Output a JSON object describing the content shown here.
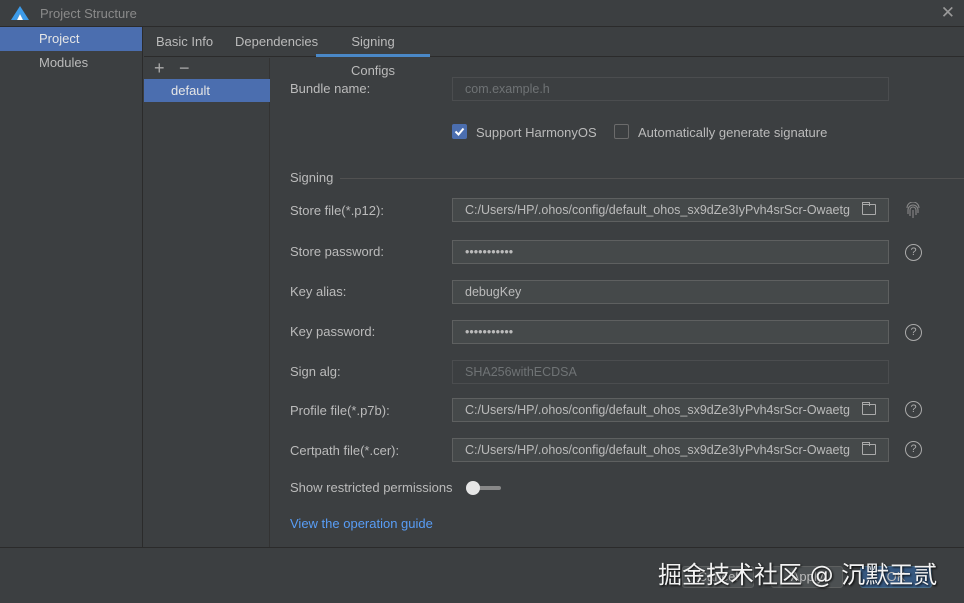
{
  "window": {
    "title": "Project Structure"
  },
  "nav": {
    "items": [
      {
        "label": "Project"
      },
      {
        "label": "Modules"
      }
    ]
  },
  "tabs": [
    {
      "label": "Basic Info"
    },
    {
      "label": "Dependencies"
    },
    {
      "label": "Signing Configs"
    }
  ],
  "configs": {
    "add": "+",
    "remove": "−",
    "items": [
      "default"
    ]
  },
  "form": {
    "bundle_name": {
      "label": "Bundle name:",
      "placeholder": "com.example.h"
    },
    "support_harmony": {
      "label": "Support HarmonyOS",
      "checked": true
    },
    "auto_sign": {
      "label": "Automatically generate signature",
      "checked": false
    },
    "section": "Signing",
    "store_file": {
      "label": "Store file(*.p12):",
      "value": "C:/Users/HP/.ohos/config/default_ohos_sx9dZe3IyPvh4srScr-Owaetg"
    },
    "store_password": {
      "label": "Store password:",
      "value": "•••••••••••"
    },
    "key_alias": {
      "label": "Key alias:",
      "value": "debugKey"
    },
    "key_password": {
      "label": "Key password:",
      "value": "•••••••••••"
    },
    "sign_alg": {
      "label": "Sign alg:",
      "value": "SHA256withECDSA"
    },
    "profile_file": {
      "label": "Profile file(*.p7b):",
      "value": "C:/Users/HP/.ohos/config/default_ohos_sx9dZe3IyPvh4srScr-Owaetg"
    },
    "certpath_file": {
      "label": "Certpath file(*.cer):",
      "value": "C:/Users/HP/.ohos/config/default_ohos_sx9dZe3IyPvh4srScr-Owaetg"
    },
    "restricted": {
      "label": "Show restricted permissions",
      "on": false
    },
    "guide": "View the operation guide",
    "help": "?"
  },
  "buttons": {
    "cancel": "Cancel",
    "apply": "Apply",
    "ok": "OK"
  },
  "watermark": "掘金技术社区 @ 沉默王贰",
  "colors": {
    "accent": "#4b6eaf",
    "link": "#589df6"
  }
}
